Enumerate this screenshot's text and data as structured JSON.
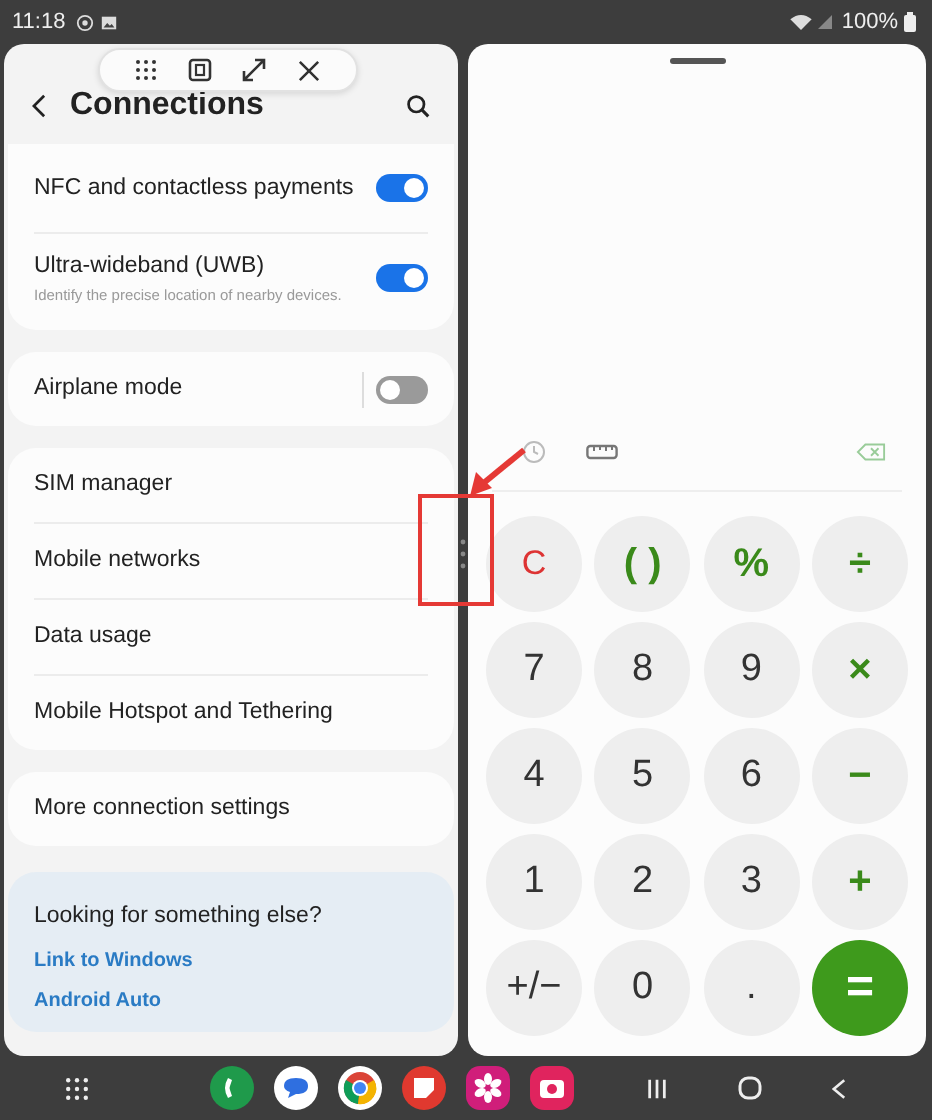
{
  "status_bar": {
    "time": "11:18",
    "battery": "100%"
  },
  "settings": {
    "title": "Connections",
    "groups": [
      {
        "items": [
          {
            "kind": "toggle",
            "label": "NFC and contactless payments",
            "on": true
          },
          {
            "kind": "toggle",
            "label": "Ultra-wideband (UWB)",
            "description": "Identify the precise location of nearby devices.",
            "on": true
          }
        ]
      },
      {
        "items": [
          {
            "kind": "toggle",
            "label": "Airplane mode",
            "on": false
          }
        ]
      },
      {
        "items": [
          {
            "kind": "link",
            "label": "SIM manager"
          },
          {
            "kind": "link",
            "label": "Mobile networks"
          },
          {
            "kind": "link",
            "label": "Data usage"
          },
          {
            "kind": "link",
            "label": "Mobile Hotspot and Tethering"
          }
        ]
      },
      {
        "items": [
          {
            "kind": "link",
            "label": "More connection settings"
          }
        ]
      }
    ],
    "suggestions": {
      "heading": "Looking for something else?",
      "links": [
        "Link to Windows",
        "Android Auto"
      ]
    }
  },
  "calculator": {
    "keys": [
      {
        "label": "C",
        "kind": "clear"
      },
      {
        "label": "( )",
        "kind": "operator"
      },
      {
        "label": "%",
        "kind": "operator"
      },
      {
        "label": "÷",
        "kind": "operator"
      },
      {
        "label": "7",
        "kind": "digit"
      },
      {
        "label": "8",
        "kind": "digit"
      },
      {
        "label": "9",
        "kind": "digit"
      },
      {
        "label": "×",
        "kind": "operator"
      },
      {
        "label": "4",
        "kind": "digit"
      },
      {
        "label": "5",
        "kind": "digit"
      },
      {
        "label": "6",
        "kind": "digit"
      },
      {
        "label": "−",
        "kind": "operator"
      },
      {
        "label": "1",
        "kind": "digit"
      },
      {
        "label": "2",
        "kind": "digit"
      },
      {
        "label": "3",
        "kind": "digit"
      },
      {
        "label": "+",
        "kind": "operator"
      },
      {
        "label": "+/−",
        "kind": "digit"
      },
      {
        "label": "0",
        "kind": "digit"
      },
      {
        "label": ".",
        "kind": "digit"
      },
      {
        "label": "=",
        "kind": "equals"
      }
    ]
  },
  "dock": {
    "apps": [
      {
        "kind": "phone",
        "color": "#1f9a4b"
      },
      {
        "kind": "messages",
        "color": "#2f6fe0"
      },
      {
        "kind": "browser",
        "color": "#ffffff"
      },
      {
        "kind": "notes",
        "color": "#e0392f"
      },
      {
        "kind": "flower",
        "color": "#d01e7a"
      },
      {
        "kind": "camera",
        "color": "#e0245e"
      }
    ]
  }
}
